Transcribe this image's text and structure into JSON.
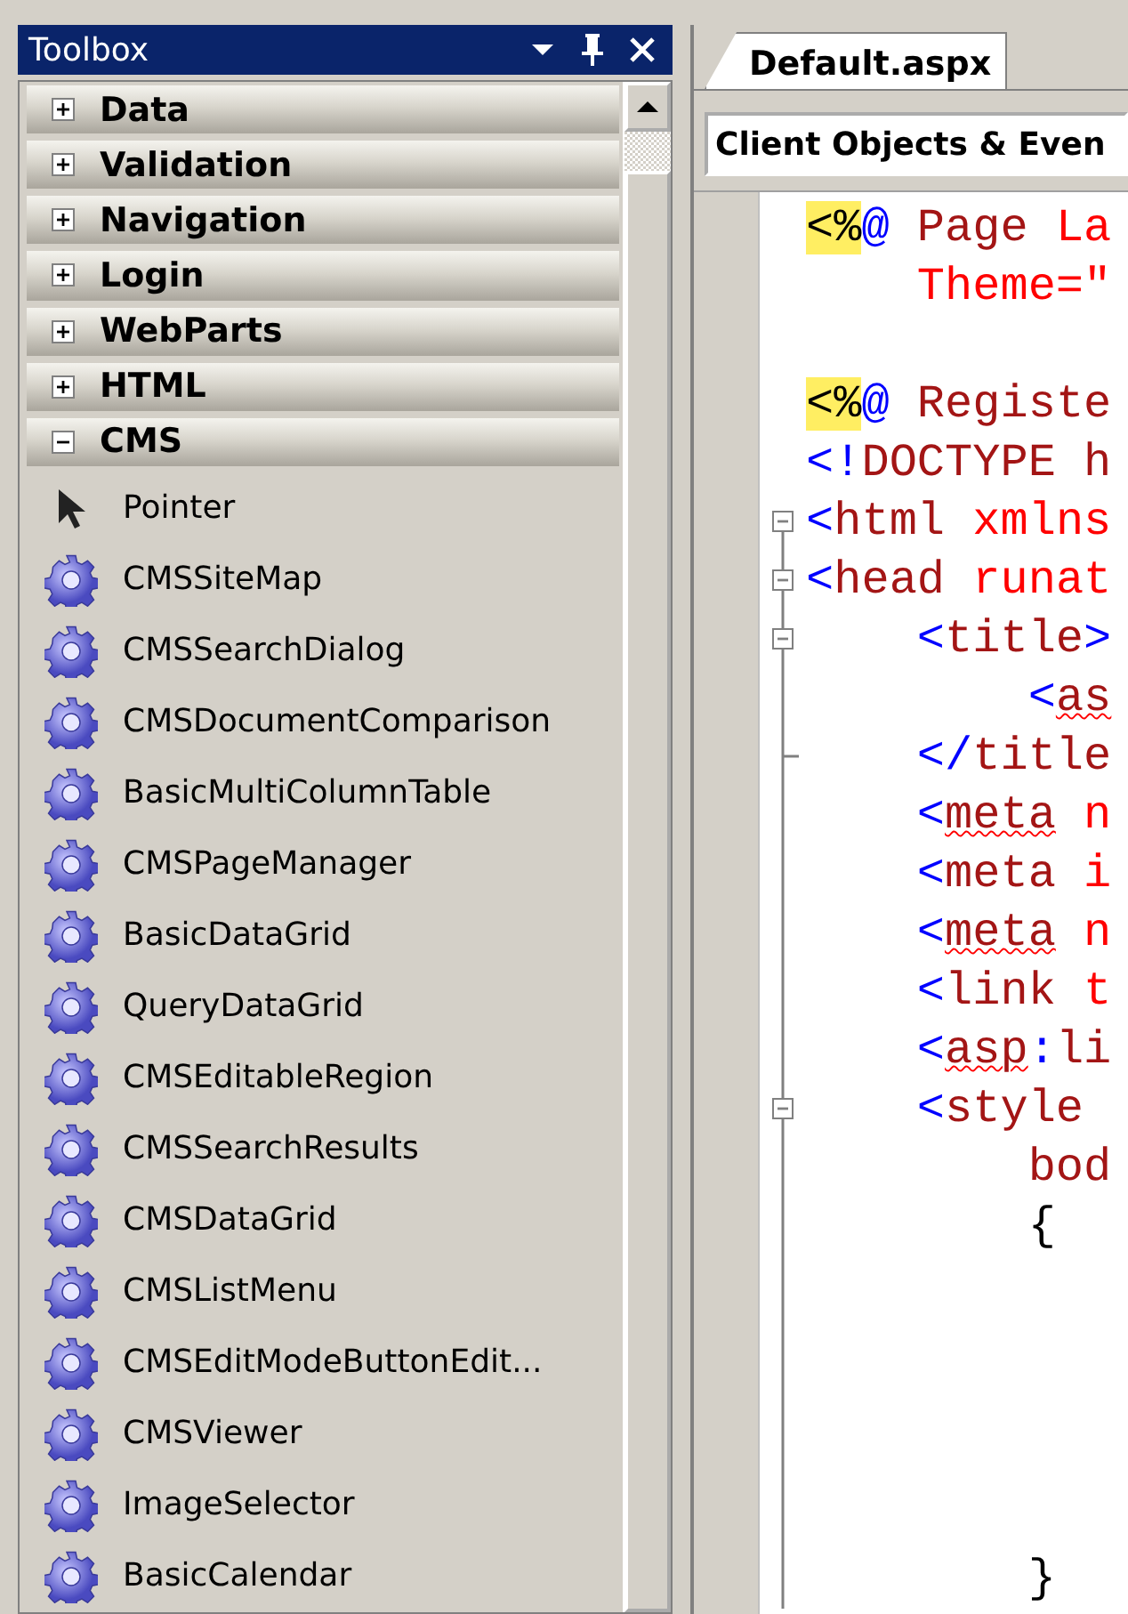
{
  "toolbox": {
    "title": "Toolbox",
    "categories": [
      {
        "label": "Data",
        "expanded": false
      },
      {
        "label": "Validation",
        "expanded": false
      },
      {
        "label": "Navigation",
        "expanded": false
      },
      {
        "label": "Login",
        "expanded": false
      },
      {
        "label": "WebParts",
        "expanded": false
      },
      {
        "label": "HTML",
        "expanded": false
      },
      {
        "label": "CMS",
        "expanded": true
      }
    ],
    "items": [
      {
        "label": "Pointer",
        "kind": "pointer"
      },
      {
        "label": "CMSSiteMap",
        "kind": "control"
      },
      {
        "label": "CMSSearchDialog",
        "kind": "control"
      },
      {
        "label": "CMSDocumentComparison",
        "kind": "control"
      },
      {
        "label": "BasicMultiColumnTable",
        "kind": "control"
      },
      {
        "label": "CMSPageManager",
        "kind": "control"
      },
      {
        "label": "BasicDataGrid",
        "kind": "control"
      },
      {
        "label": "QueryDataGrid",
        "kind": "control"
      },
      {
        "label": "CMSEditableRegion",
        "kind": "control"
      },
      {
        "label": "CMSSearchResults",
        "kind": "control"
      },
      {
        "label": "CMSDataGrid",
        "kind": "control"
      },
      {
        "label": "CMSListMenu",
        "kind": "control"
      },
      {
        "label": "CMSEditModeButtonEdit...",
        "kind": "control"
      },
      {
        "label": "CMSViewer",
        "kind": "control"
      },
      {
        "label": "ImageSelector",
        "kind": "control"
      },
      {
        "label": "BasicCalendar",
        "kind": "control"
      }
    ]
  },
  "editor": {
    "tabs": [
      {
        "label": "Default.aspx",
        "selected": true
      }
    ],
    "object_dropdown": "Client Objects & Even",
    "code_lines": [
      {
        "kind": "plain",
        "tokens": [
          {
            "kind": "directive",
            "text": "<%"
          },
          {
            "kind": "delimiter",
            "text": "@"
          },
          {
            "kind": "element",
            "text": " Page"
          },
          {
            "kind": "attribute",
            "text": " La"
          }
        ]
      },
      {
        "kind": "plain",
        "tokens": [
          {
            "kind": "attribute",
            "text": "    Theme=\""
          }
        ]
      },
      {
        "kind": "plain"
      },
      {
        "kind": "plain",
        "tokens": [
          {
            "kind": "directive",
            "text": "<%"
          },
          {
            "kind": "delimiter",
            "text": "@"
          },
          {
            "kind": "element",
            "text": " Registe"
          }
        ]
      },
      {
        "kind": "plain",
        "tokens": [
          {
            "kind": "delimiter",
            "text": "<!"
          },
          {
            "kind": "element",
            "text": "DOCTYPE h"
          }
        ]
      },
      {
        "kind": "collapsible",
        "tokens": [
          {
            "kind": "delimiter",
            "text": "<"
          },
          {
            "kind": "element",
            "text": "html"
          },
          {
            "kind": "attribute",
            "text": " xmlns"
          }
        ]
      },
      {
        "kind": "collapsible",
        "tokens": [
          {
            "kind": "delimiter",
            "text": "<"
          },
          {
            "kind": "element",
            "text": "head"
          },
          {
            "kind": "attribute",
            "text": " runat"
          }
        ]
      },
      {
        "kind": "collapsible",
        "tokens": [
          {
            "kind": "delimiter",
            "text": "    <"
          },
          {
            "kind": "element",
            "text": "title"
          },
          {
            "kind": "delimiter",
            "text": ">"
          }
        ]
      },
      {
        "kind": "plain",
        "tokens": [
          {
            "kind": "delimiter",
            "text": "        <"
          },
          {
            "kind": "error",
            "text": "as"
          }
        ]
      },
      {
        "kind": "block_end",
        "tokens": [
          {
            "kind": "delimiter",
            "text": "    </"
          },
          {
            "kind": "element",
            "text": "title"
          }
        ]
      },
      {
        "kind": "plain",
        "tokens": [
          {
            "kind": "delimiter",
            "text": "    <"
          },
          {
            "kind": "error",
            "text": "meta"
          },
          {
            "kind": "attribute",
            "text": " n"
          }
        ]
      },
      {
        "kind": "plain",
        "tokens": [
          {
            "kind": "delimiter",
            "text": "    <"
          },
          {
            "kind": "element",
            "text": "meta"
          },
          {
            "kind": "attribute",
            "text": " i"
          }
        ]
      },
      {
        "kind": "plain",
        "tokens": [
          {
            "kind": "delimiter",
            "text": "    <"
          },
          {
            "kind": "error",
            "text": "meta"
          },
          {
            "kind": "attribute",
            "text": " n"
          }
        ]
      },
      {
        "kind": "plain",
        "tokens": [
          {
            "kind": "delimiter",
            "text": "    <"
          },
          {
            "kind": "element",
            "text": "link"
          },
          {
            "kind": "attribute",
            "text": " t"
          }
        ]
      },
      {
        "kind": "plain",
        "tokens": [
          {
            "kind": "delimiter",
            "text": "    <"
          },
          {
            "kind": "error",
            "text": "asp"
          },
          {
            "kind": "delimiter",
            "text": ":"
          },
          {
            "kind": "element",
            "text": "li"
          }
        ]
      },
      {
        "kind": "collapsible",
        "tokens": [
          {
            "kind": "delimiter",
            "text": "    <"
          },
          {
            "kind": "element",
            "text": "style"
          }
        ]
      },
      {
        "kind": "plain",
        "tokens": [
          {
            "kind": "element",
            "text": "        bod"
          }
        ]
      },
      {
        "kind": "plain",
        "tokens": [
          {
            "kind": "plain",
            "text": "        {"
          }
        ]
      },
      {
        "kind": "plain"
      },
      {
        "kind": "plain"
      },
      {
        "kind": "plain"
      },
      {
        "kind": "plain"
      },
      {
        "kind": "plain"
      },
      {
        "kind": "plain",
        "tokens": [
          {
            "kind": "plain",
            "text": "        }"
          }
        ]
      }
    ]
  }
}
